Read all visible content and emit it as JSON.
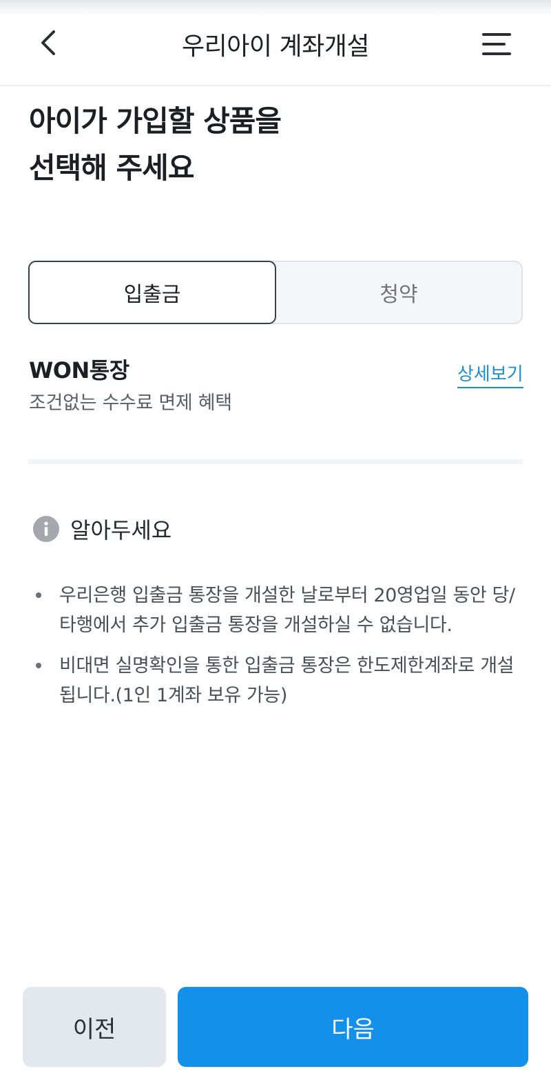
{
  "header": {
    "title": "우리아이 계좌개설",
    "back_icon": "chevron-left-icon",
    "menu_icon": "hamburger-menu-icon"
  },
  "page": {
    "title_line1": "아이가 가입할 상품을",
    "title_line2": "선택해 주세요"
  },
  "tabs": [
    {
      "label": "입출금",
      "selected": true
    },
    {
      "label": "청약",
      "selected": false
    }
  ],
  "product": {
    "name": "WON통장",
    "description": "조건없는 수수료 면제 혜택",
    "detail_link": "상세보기"
  },
  "notice": {
    "icon": "info-icon",
    "title": "알아두세요",
    "items": [
      "우리은행 입출금 통장을 개설한 날로부터 20영업일 동안 당/타행에서 추가 입출금 통장을 개설하실 수 없습니다.",
      "비대면 실명확인을 통한 입출금 통장은 한도제한계좌로 개설됩니다.(1인 1계좌 보유 가능)"
    ]
  },
  "footer": {
    "prev_label": "이전",
    "next_label": "다음"
  },
  "colors": {
    "accent": "#1390ea",
    "link": "#1a8fd8",
    "secondary_button": "#e3e8ef"
  }
}
